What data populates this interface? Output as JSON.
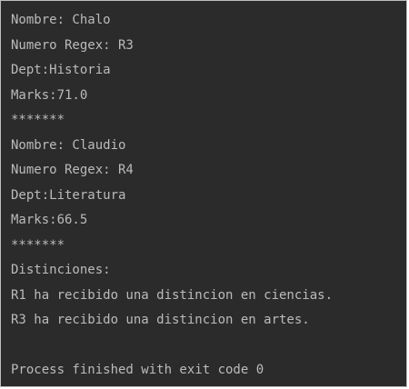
{
  "console": {
    "lines": [
      "Nombre: Chalo",
      "Numero Regex: R3",
      "Dept:Historia",
      "Marks:71.0",
      "*******",
      "Nombre: Claudio",
      "Numero Regex: R4",
      "Dept:Literatura",
      "Marks:66.5",
      "*******",
      "Distinciones:",
      "R1 ha recibido una distincion en ciencias.",
      "R3 ha recibido una distincion en artes.",
      "",
      "Process finished with exit code 0"
    ]
  },
  "colors": {
    "background": "#2b2b2b",
    "text": "#bbbbbb",
    "border": "#bdbdbd"
  }
}
